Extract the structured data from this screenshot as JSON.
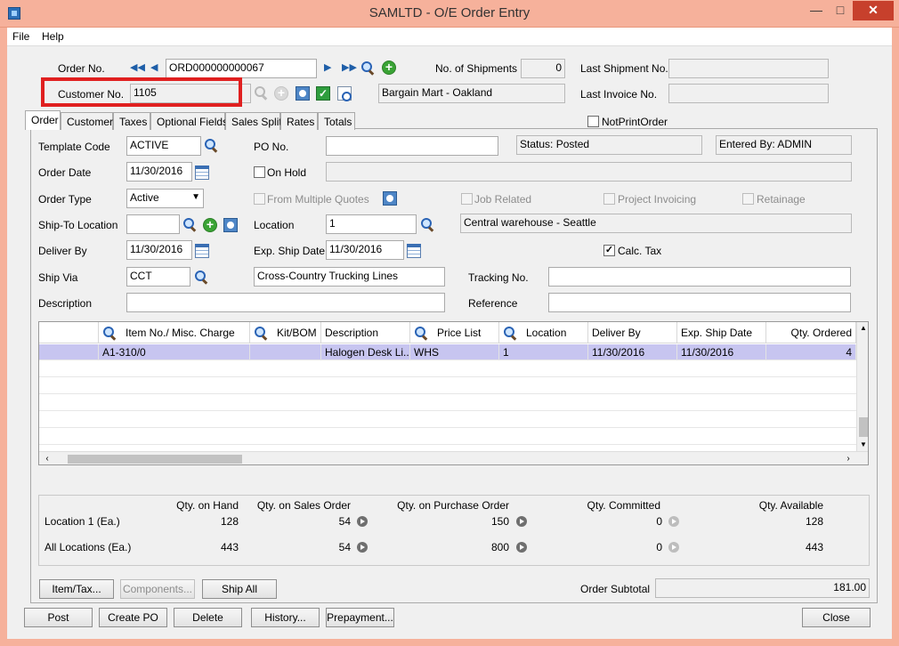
{
  "window": {
    "title": "SAMLTD - O/E Order Entry"
  },
  "menu": {
    "file": "File",
    "help": "Help"
  },
  "header": {
    "order_no_label": "Order No.",
    "order_no": "ORD000000000067",
    "no_shipments_label": "No. of Shipments",
    "no_shipments": "0",
    "last_shipment_label": "Last Shipment No.",
    "last_shipment": "",
    "customer_no_label": "Customer No.",
    "customer_no": "1105",
    "customer_name": "Bargain Mart - Oakland",
    "last_invoice_label": "Last Invoice No.",
    "last_invoice": "",
    "not_print_order_label": "NotPrintOrder"
  },
  "tabs": [
    "Order",
    "Customer",
    "Taxes",
    "Optional Fields",
    "Sales Split",
    "Rates",
    "Totals"
  ],
  "order_tab": {
    "template_code_label": "Template Code",
    "template_code": "ACTIVE",
    "po_no_label": "PO No.",
    "po_no": "",
    "status": "Status: Posted",
    "entered_by": "Entered By: ADMIN",
    "order_date_label": "Order Date",
    "order_date": "11/30/2016",
    "on_hold_label": "On Hold",
    "order_type_label": "Order Type",
    "order_type": "Active",
    "from_multiple_quotes_label": "From Multiple Quotes",
    "job_related_label": "Job Related",
    "project_invoicing_label": "Project Invoicing",
    "retainage_label": "Retainage",
    "ship_to_label": "Ship-To Location",
    "ship_to": "",
    "location_label": "Location",
    "location": "1",
    "location_desc": "Central warehouse - Seattle",
    "deliver_by_label": "Deliver By",
    "deliver_by": "11/30/2016",
    "exp_ship_date_label": "Exp. Ship Date",
    "exp_ship_date": "11/30/2016",
    "calc_tax_label": "Calc. Tax",
    "ship_via_label": "Ship Via",
    "ship_via": "CCT",
    "ship_via_desc": "Cross-Country Trucking Lines",
    "tracking_no_label": "Tracking No.",
    "tracking_no": "",
    "description_label": "Description",
    "description": "",
    "reference_label": "Reference",
    "reference": ""
  },
  "grid": {
    "columns": [
      "Item No./ Misc. Charge",
      "Kit/BOM",
      "Description",
      "Price List",
      "Location",
      "Deliver By",
      "Exp. Ship Date",
      "Qty. Ordered"
    ],
    "rows": [
      [
        "A1-310/0",
        "",
        "Halogen Desk Li...",
        "WHS",
        "1",
        "11/30/2016",
        "11/30/2016",
        "4"
      ]
    ]
  },
  "quantities": {
    "headers": [
      "Qty. on Hand",
      "Qty. on Sales Order",
      "Qty. on Purchase Order",
      "Qty. Committed",
      "Qty. Available"
    ],
    "rows": [
      {
        "label": "Location  1 (Ea.)",
        "values": [
          "128",
          "54",
          "150",
          "0",
          "128"
        ]
      },
      {
        "label": "All Locations (Ea.)",
        "values": [
          "443",
          "54",
          "800",
          "0",
          "443"
        ]
      }
    ]
  },
  "buttons": {
    "item_tax": "Item/Tax...",
    "components": "Components...",
    "ship_all": "Ship All",
    "order_subtotal_label": "Order Subtotal",
    "order_subtotal": "181.00",
    "post": "Post",
    "create_po": "Create PO",
    "delete": "Delete",
    "history": "History...",
    "prepayment": "Prepayment...",
    "close": "Close"
  }
}
